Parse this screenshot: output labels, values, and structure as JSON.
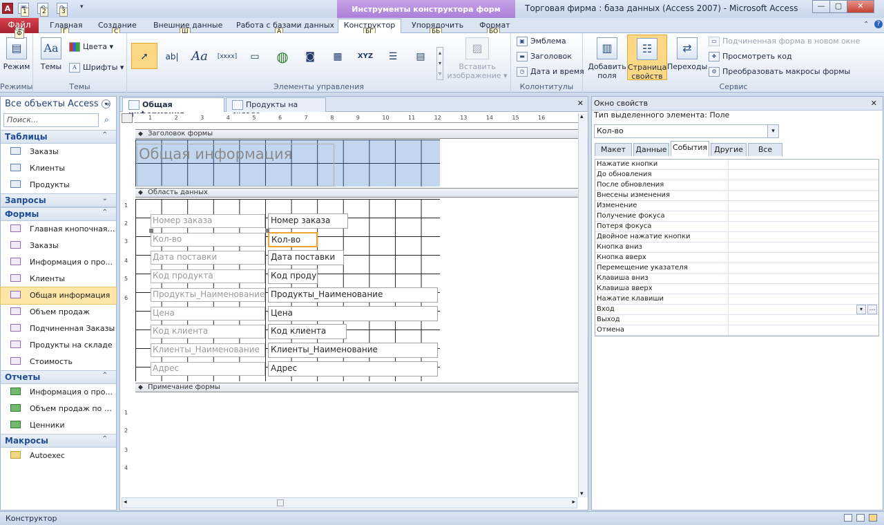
{
  "window": {
    "title": "Торговая фирма : база данных (Access 2007)  -  Microsoft Access",
    "context_header": "Инструменты конструктора форм",
    "btn_minimize": "—",
    "btn_maximize": "▢",
    "btn_close": "✕",
    "app_glyph": "A",
    "qat_keytips": [
      "1",
      "2",
      "3"
    ]
  },
  "ribbon_tabs": [
    {
      "label": "Файл",
      "keytip": "Ф"
    },
    {
      "label": "Главная",
      "keytip": "Г"
    },
    {
      "label": "Создание",
      "keytip": "С"
    },
    {
      "label": "Внешние данные",
      "keytip": "Ш"
    },
    {
      "label": "Работа с базами данных",
      "keytip": "А"
    },
    {
      "label": "Конструктор",
      "keytip": "БГ"
    },
    {
      "label": "Упорядочить",
      "keytip": "БЬ"
    },
    {
      "label": "Формат",
      "keytip": "БО"
    }
  ],
  "ribbon": {
    "views": {
      "label": "Режимы",
      "button": "Режим"
    },
    "themes": {
      "label": "Темы",
      "button": "Темы",
      "colors": "Цвета",
      "fonts": "Шрифты"
    },
    "controls": {
      "label": "Элементы управления",
      "insert_image": [
        "Вставить",
        "изображение"
      ]
    },
    "header_footer": {
      "label": "Колонтитулы",
      "logo": "Эмблема",
      "title": "Заголовок",
      "datetime": "Дата и время"
    },
    "tools": {
      "label": "Сервис",
      "add_fields": [
        "Добавить",
        "поля"
      ],
      "property_sheet": [
        "Страница",
        "свойств"
      ],
      "tab_order": "Переходы",
      "subform_new_window": "Подчиненная форма в новом окне",
      "view_code": "Просмотреть код",
      "convert_macros": "Преобразовать макросы формы"
    }
  },
  "nav": {
    "header": "Все объекты Access",
    "search_placeholder": "Поиск...",
    "sections": [
      {
        "title": "Таблицы",
        "type": "table",
        "items": [
          "Заказы",
          "Клиенты",
          "Продукты"
        ]
      },
      {
        "title": "Запросы",
        "type": "query",
        "items": []
      },
      {
        "title": "Формы",
        "type": "form",
        "items": [
          "Главная кнопочная ...",
          "Заказы",
          "Информация о про...",
          "Клиенты",
          "Общая информация",
          "Объем продаж",
          "Подчиненная Заказы",
          "Продукты на складе",
          "Стоимость"
        ]
      },
      {
        "title": "Отчеты",
        "type": "report",
        "items": [
          "Информация о про...",
          "Объем продаж по м...",
          "Ценники"
        ]
      },
      {
        "title": "Макросы",
        "type": "macro",
        "items": [
          "Autoexec"
        ]
      }
    ],
    "selected": "Общая информация"
  },
  "doc": {
    "tabs": [
      "Общая информация",
      "Продукты на складе"
    ],
    "close": "✕",
    "ruler_h": [
      "1",
      "2",
      "3",
      "4",
      "5",
      "6",
      "7",
      "8",
      "9",
      "10",
      "11",
      "12",
      "13",
      "14",
      "15",
      "16"
    ],
    "ruler_v": [
      "1",
      "2",
      "3",
      "4",
      "5",
      "6",
      "1",
      "2",
      "3",
      "4"
    ],
    "sections": {
      "header": "Заголовок формы",
      "detail": "Область данных",
      "footer": "Примечание формы"
    },
    "form_title": "Общая информация",
    "fields": [
      {
        "label": "Номер заказа",
        "value": "Номер заказа"
      },
      {
        "label": "Кол-во",
        "value": "Кол-во"
      },
      {
        "label": "Дата поставки",
        "value": "Дата поставки"
      },
      {
        "label": "Код продукта",
        "value": "Код проду"
      },
      {
        "label": "Продукты_Наименование",
        "value": "Продукты_Наименование"
      },
      {
        "label": "Цена",
        "value": "Цена"
      },
      {
        "label": "Код клиента",
        "value": "Код клиента"
      },
      {
        "label": "Клиенты_Наименование",
        "value": "Клиенты_Наименование"
      },
      {
        "label": "Адрес",
        "value": "Адрес"
      }
    ]
  },
  "props": {
    "title": "Окно свойств",
    "selection_type": "Тип выделенного элемента:  Поле",
    "selected_object": "Кол-во",
    "tabs": [
      "Макет",
      "Данные",
      "События",
      "Другие",
      "Все"
    ],
    "active_tab": "События",
    "rows": [
      "Нажатие кнопки",
      "До обновления",
      "После обновления",
      "Внесены изменения",
      "Изменение",
      "Получение фокуса",
      "Потеря фокуса",
      "Двойное нажатие кнопки",
      "Кнопка вниз",
      "Кнопка вверх",
      "Перемещение указателя",
      "Клавиша вниз",
      "Клавиша вверх",
      "Нажатие клавиши",
      "Вход",
      "Выход",
      "Отмена"
    ]
  },
  "status": {
    "text": "Конструктор"
  }
}
